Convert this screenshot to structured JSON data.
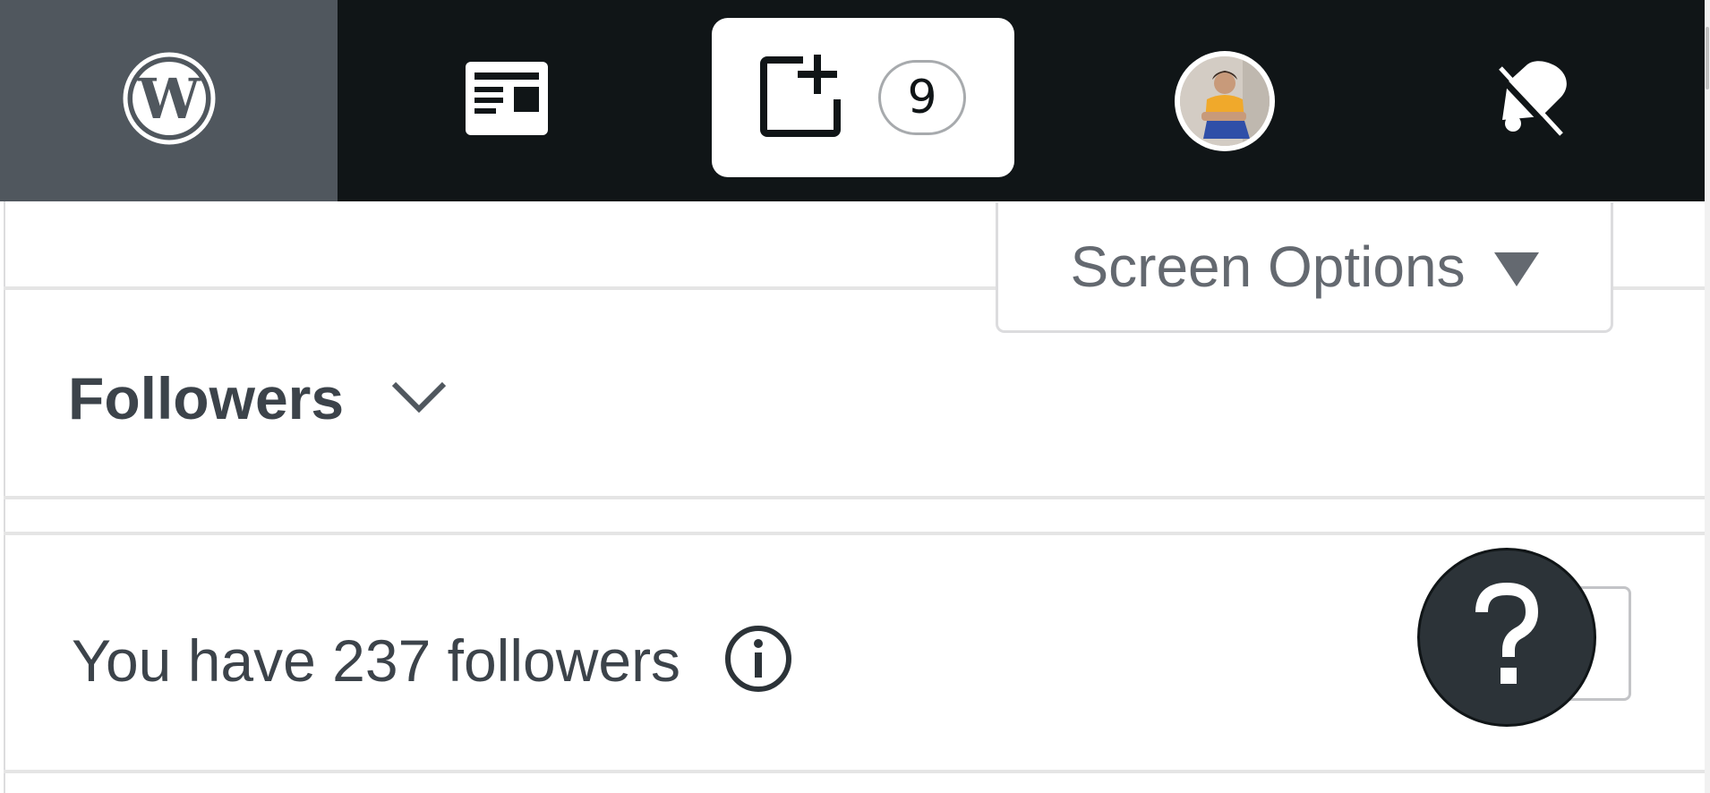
{
  "masterbar": {
    "wordpress_icon": "wordpress-logo-icon",
    "reader_icon": "reader-icon",
    "write_icon": "write-post-icon",
    "draft_count": "9",
    "avatar_icon": "user-avatar",
    "notifications_icon": "bell-icon"
  },
  "screen_options": {
    "label": "Screen Options"
  },
  "section": {
    "title": "Followers",
    "count_text": "You have 237 followers"
  },
  "colors": {
    "masterbar_bg": "#101517",
    "wp_item_bg": "#50575e",
    "text_primary": "#3c434a",
    "text_secondary": "#646970",
    "help_button_bg": "#2c3338"
  }
}
